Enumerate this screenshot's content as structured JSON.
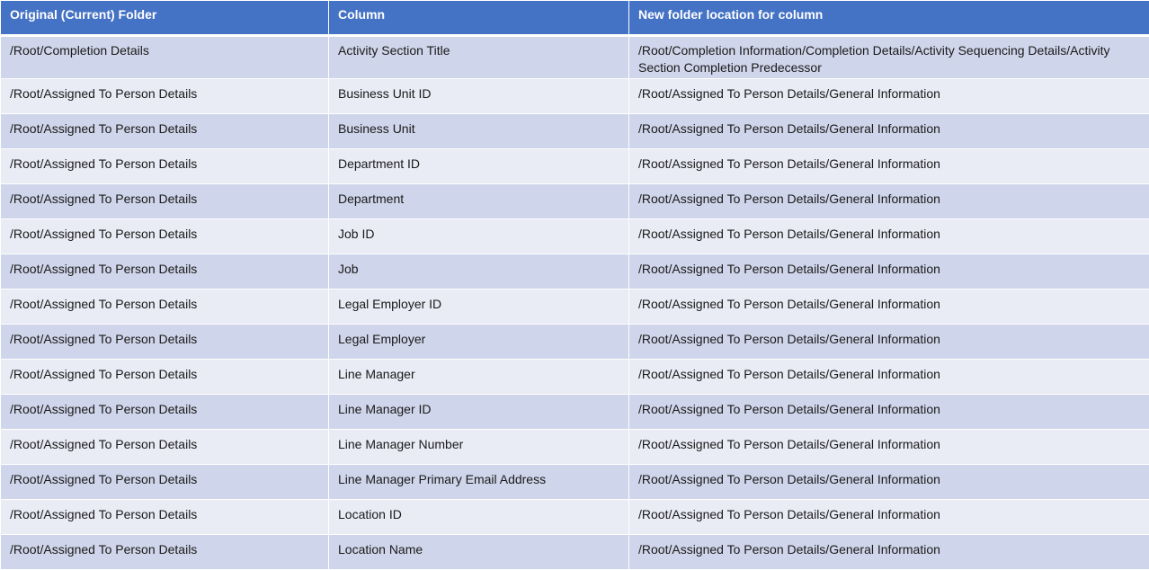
{
  "table": {
    "headers": [
      "Original (Current) Folder",
      "Column",
      "New folder location for column"
    ],
    "rows": [
      [
        "/Root/Completion  Details",
        "Activity Section Title",
        "/Root/Completion  Information/Completion  Details/Activity Sequencing Details/Activity Section Completion  Predecessor"
      ],
      [
        "/Root/Assigned To Person Details",
        "Business Unit ID",
        "/Root/Assigned To Person Details/General Information"
      ],
      [
        "/Root/Assigned To Person Details",
        "Business Unit",
        "/Root/Assigned To Person Details/General Information"
      ],
      [
        "/Root/Assigned To Person Details",
        "Department  ID",
        "/Root/Assigned To Person Details/General Information"
      ],
      [
        "/Root/Assigned To Person Details",
        "Department",
        "/Root/Assigned To Person Details/General Information"
      ],
      [
        "/Root/Assigned To Person Details",
        "Job  ID",
        "/Root/Assigned To Person Details/General Information"
      ],
      [
        "/Root/Assigned To Person Details",
        "Job",
        "/Root/Assigned To Person Details/General Information"
      ],
      [
        "/Root/Assigned To Person Details",
        "Legal Employer ID",
        "/Root/Assigned To Person Details/General Information"
      ],
      [
        "/Root/Assigned To Person Details",
        "Legal Employer",
        "/Root/Assigned To Person Details/General Information"
      ],
      [
        "/Root/Assigned To Person Details",
        "Line Manager",
        "/Root/Assigned To Person Details/General Information"
      ],
      [
        "/Root/Assigned To Person Details",
        "Line Manager ID",
        "/Root/Assigned To Person Details/General Information"
      ],
      [
        "/Root/Assigned To Person Details",
        "Line Manager Number",
        "/Root/Assigned To Person Details/General Information"
      ],
      [
        "/Root/Assigned To Person Details",
        "Line Manager Primary  Email Address",
        "/Root/Assigned To Person Details/General Information"
      ],
      [
        "/Root/Assigned To Person Details",
        "Location ID",
        "/Root/Assigned To Person Details/General Information"
      ],
      [
        "/Root/Assigned To Person Details",
        "Location Name",
        "/Root/Assigned To Person Details/General Information"
      ]
    ]
  },
  "colors": {
    "header_bg": "#4472c4",
    "row_odd": "#cfd5ea",
    "row_even": "#e9ebf5"
  }
}
